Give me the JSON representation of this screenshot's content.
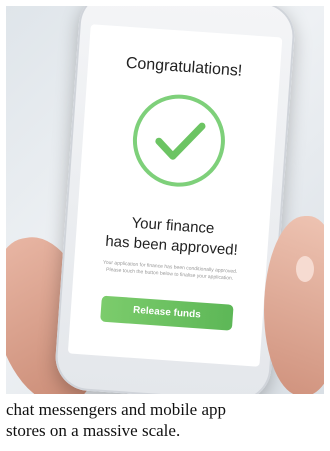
{
  "phone_screen": {
    "title": "Congratulations!",
    "message_line1": "Your finance",
    "message_line2": "has been approved!",
    "fine_print": "Your application for finance has been conditionally approved. Please touch the button below to finalise your application.",
    "button_label": "Release funds",
    "accent_color": "#6cc463"
  },
  "caption": {
    "line1": "chat messengers and mobile app",
    "line2": "stores on a massive scale."
  }
}
